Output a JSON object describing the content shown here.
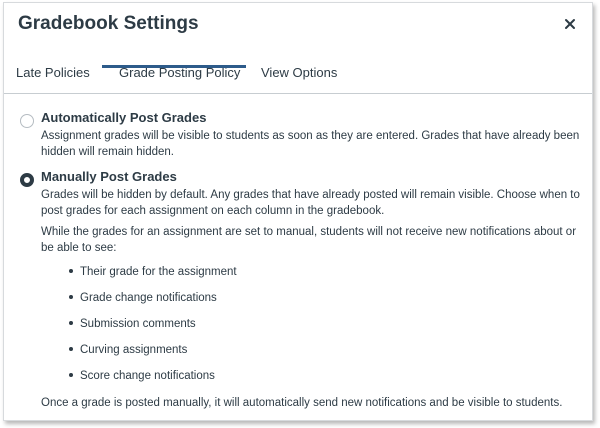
{
  "dialog": {
    "title": "Gradebook Settings",
    "close_label": "×"
  },
  "tabs": [
    {
      "label": "Late Policies",
      "active": false
    },
    {
      "label": "Grade Posting Policy",
      "active": true
    },
    {
      "label": "View Options",
      "active": false
    }
  ],
  "policy": {
    "options": [
      {
        "title": "Automatically Post Grades",
        "description": "Assignment grades will be visible to students as soon as they are entered. Grades that have already been hidden will remain hidden.",
        "selected": false
      },
      {
        "title": "Manually Post Grades",
        "description": "Grades will be hidden by default. Any grades that have already posted will remain visible. Choose when to post grades for each assignment on each column in the gradebook.",
        "selected": true
      }
    ],
    "manual_note": "While the grades for an assignment are set to manual, students will not receive new notifications about or be able to see:",
    "manual_items": [
      "Their grade for the assignment",
      "Grade change notifications",
      "Submission comments",
      "Curving assignments",
      "Score change notifications"
    ],
    "footer_note": "Once a grade is posted manually, it will automatically send new notifications and be visible to students."
  },
  "colors": {
    "text": "#2d3b45",
    "active_tab_underline": "#2d5b8a",
    "divider": "#c7cdd1"
  }
}
